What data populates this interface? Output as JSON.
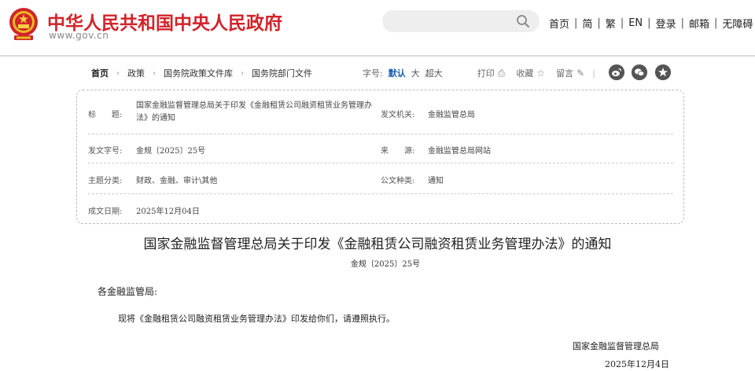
{
  "header": {
    "site_title": "中华人民共和国中央人民政府",
    "site_domain": "www.gov.cn",
    "search": {
      "placeholder": ""
    },
    "nav": [
      "首页",
      "简",
      "繁",
      "EN",
      "登录",
      "邮箱",
      "无障碍"
    ],
    "separator": "|"
  },
  "breadcrumb": [
    "首页",
    "政策",
    "国务院政策文件库",
    "国务院部门文件"
  ],
  "tools": {
    "font_size_label": "字号:",
    "font_options": [
      "默认",
      "大",
      "超大"
    ],
    "active_font": "默认",
    "print": "打印",
    "favorite": "收藏",
    "comment": "留言",
    "share_icons": [
      "weibo-icon",
      "wechat-icon",
      "star-share-icon"
    ]
  },
  "meta": {
    "title_label": "标　　题:",
    "title_value": "国家金融监督管理总局关于印发《金融租赁公司融资租赁业务管理办法》的通知",
    "issuer_label": "发文机关:",
    "issuer_value": "金融监管总局",
    "doc_no_label": "发文字号:",
    "doc_no_value": "金规〔2025〕25号",
    "source_label": "来　　源:",
    "source_value": "金融监管总局网站",
    "topic_label": "主题分类:",
    "topic_value": "财政、金融、审计\\其他",
    "doc_type_label": "公文种类:",
    "doc_type_value": "通知",
    "date_label": "成文日期:",
    "date_value": "2025年12月04日"
  },
  "document": {
    "title": "国家金融监督管理总局关于印发《金融租赁公司融资租赁业务管理办法》的通知",
    "number": "金规〔2025〕25号",
    "salutation": "各金融监管局:",
    "body": "现将《金融租赁公司融资租赁业务管理办法》印发给你们，请遵照执行。",
    "signer": "国家金融监督管理总局",
    "date": "2025年12月4日"
  },
  "colors": {
    "brand_red": "#d2232a",
    "active_blue": "#1a5fb4"
  }
}
